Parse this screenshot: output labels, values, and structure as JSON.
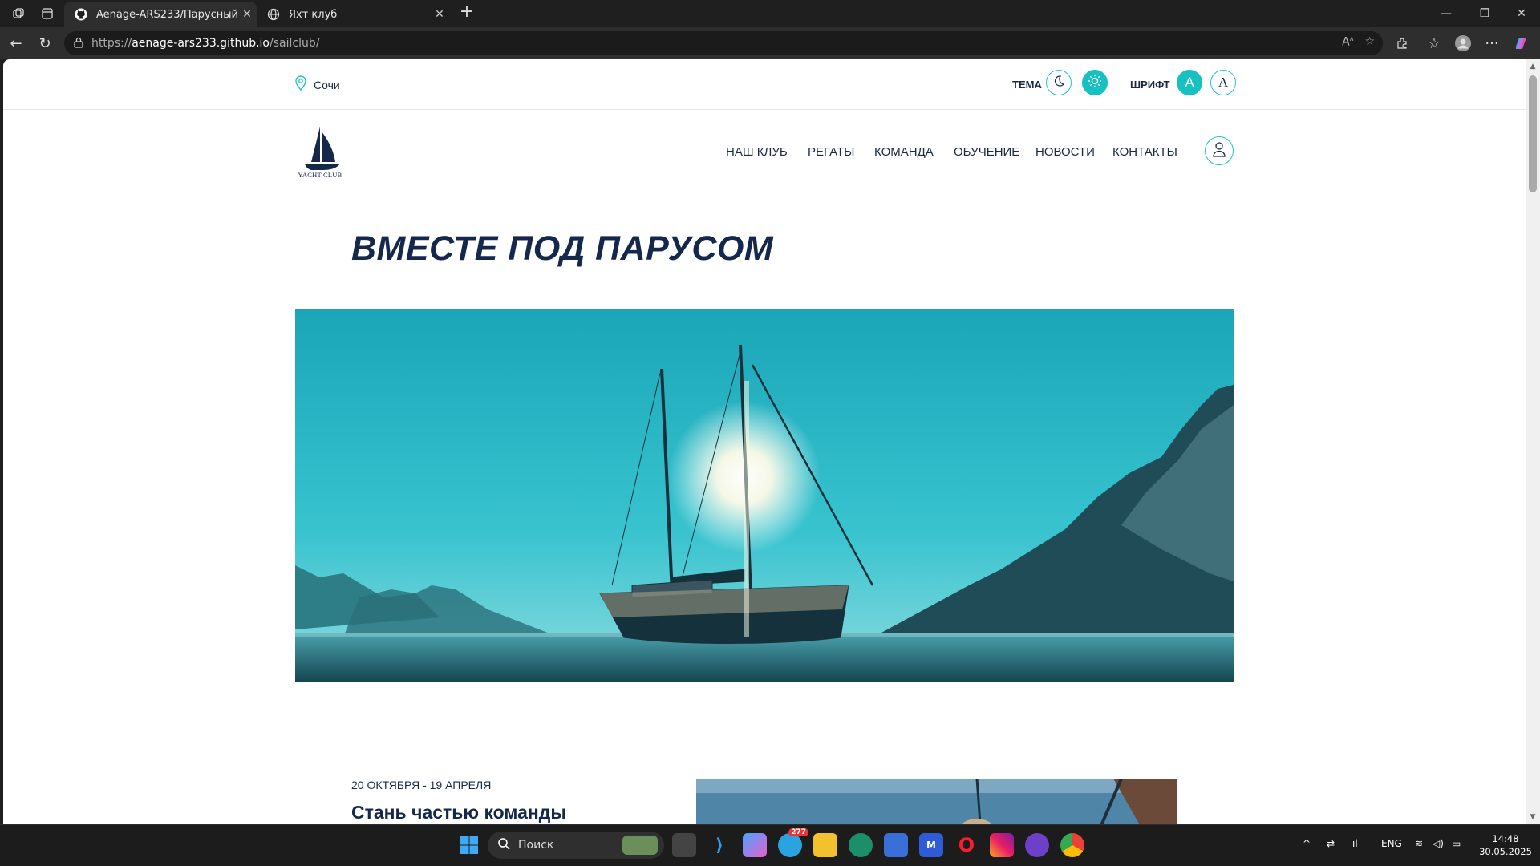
{
  "browser": {
    "tabs": [
      {
        "title": "Aenage-ARS233/Парусный клуб",
        "favicon": "github-icon",
        "active": true
      },
      {
        "title": "Яхт клуб",
        "favicon": "globe-icon",
        "active": false
      }
    ],
    "url_prefix": "https://",
    "url_host": "aenage-ars233.github.io",
    "url_path": "/sailclub/"
  },
  "site": {
    "location": "Сочи",
    "theme_label": "ТЕМА",
    "font_label": "ШРИФТ",
    "font_option_1": "A",
    "font_option_2": "A",
    "logo_text": "YACHT CLUB",
    "nav": [
      "НАШ КЛУБ",
      "РЕГАТЫ",
      "КОМАНДА",
      "ОБУЧЕНИЕ",
      "НОВОСТИ",
      "КОНТАКТЫ"
    ],
    "hero_title": "ВМЕСТЕ ПОД ПАРУСОМ",
    "event": {
      "dates": "20 ОКТЯБРЯ - 19 АПРЕЛЯ",
      "title": "Стань частью команды"
    },
    "colors": {
      "accent": "#17c1c1",
      "navy": "#15284b"
    }
  },
  "taskbar": {
    "search_placeholder": "Поиск",
    "telegram_badge": "277",
    "language": "ENG",
    "time": "14:48",
    "date": "30.05.2025"
  }
}
